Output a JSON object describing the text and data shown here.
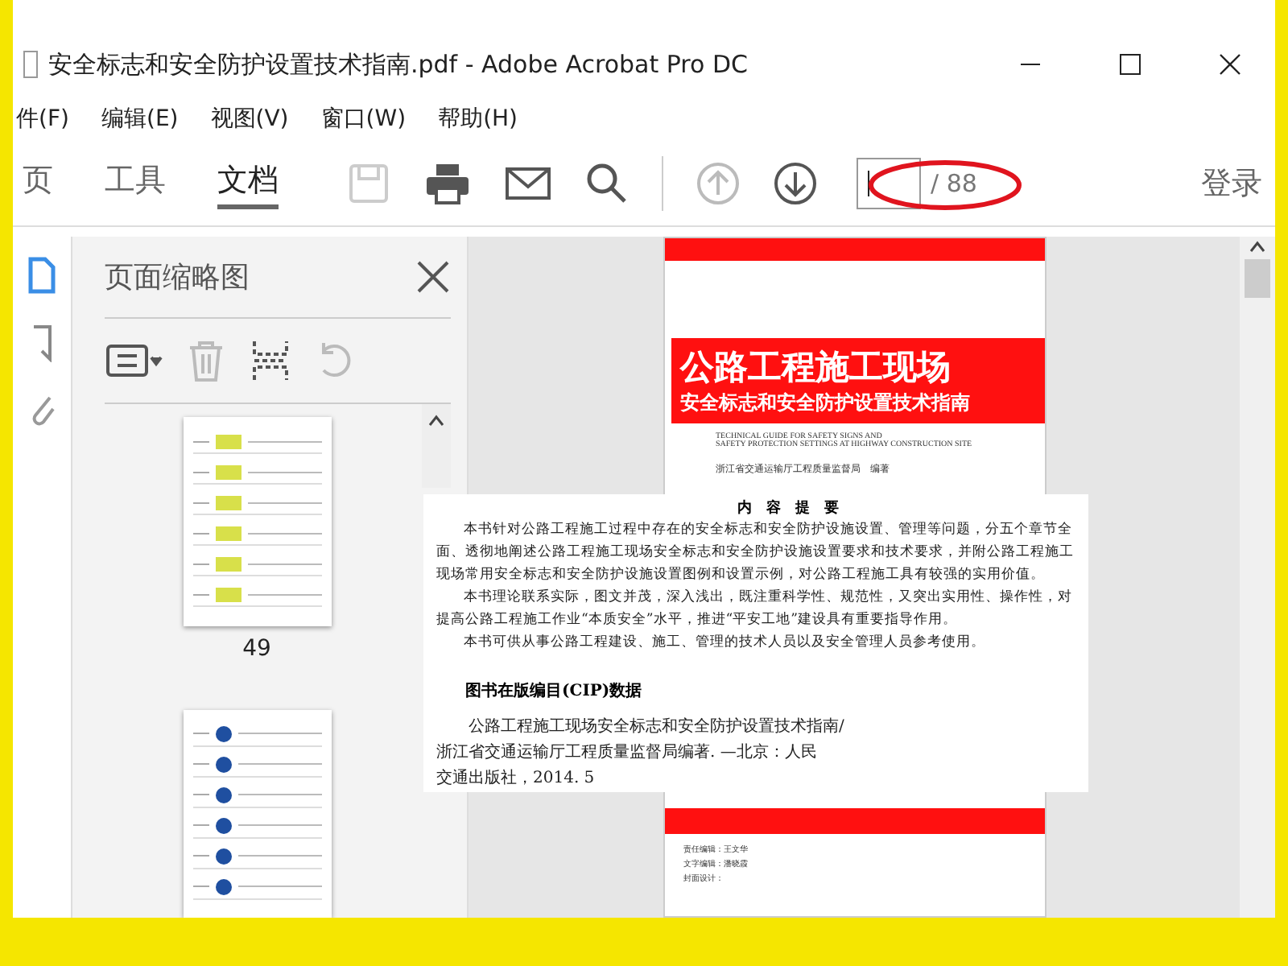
{
  "window": {
    "title": "安全标志和安全防护设置技术指南.pdf - Adobe Acrobat Pro DC"
  },
  "menu": [
    "件(F)",
    "编辑(E)",
    "视图(V)",
    "窗口(W)",
    "帮助(H)"
  ],
  "tabs": [
    {
      "label": "页",
      "selected": false
    },
    {
      "label": "工具",
      "selected": false
    },
    {
      "label": "文档",
      "selected": true
    }
  ],
  "page_nav": {
    "total": "/ 88"
  },
  "sign_in": "登录",
  "side_panel": {
    "title": "页面缩略图",
    "thumbnails": [
      {
        "label": "49",
        "kind": "table"
      },
      {
        "kind": "icons"
      }
    ]
  },
  "document": {
    "title": "公路工程施工现场",
    "subtitle": "安全标志和安全防护设置技术指南",
    "english": [
      "TECHNICAL GUIDE FOR SAFETY SIGNS AND",
      "SAFETY PROTECTION SETTINGS AT HIGHWAY CONSTRUCTION SITE"
    ],
    "publisher": "浙江省交通运输厅工程质量监督局　编著",
    "credits": [
      "责任编辑：王文华",
      "文字编辑：潘晓霞",
      "封面设计："
    ]
  },
  "overlay": {
    "heading": "内　容　提　要",
    "paragraphs": [
      "本书针对公路工程施工过程中存在的安全标志和安全防护设施设置、管理等问题，分五个章节全面、透彻地阐述公路工程施工现场安全标志和安全防护设施设置要求和技术要求，并附公路工程施工现场常用安全标志和安全防护设施设置图例和设置示例，对公路工程施工具有较强的实用价值。",
      "本书理论联系实际，图文并茂，深入浅出，既注重科学性、规范性，又突出实用性、操作性，对提高公路工程施工作业“本质安全”水平，推进“平安工地”建设具有重要指导作用。",
      "本书可供从事公路工程建设、施工、管理的技术人员以及安全管理人员参考使用。"
    ],
    "cip_heading": "图书在版编目(CIP)数据",
    "cip_lines": [
      "公路工程施工现场安全标志和安全防护设置技术指南/",
      "浙江省交通运输厅工程质量监督局编著. —北京：人民",
      "交通出版社，2014. 5"
    ]
  }
}
